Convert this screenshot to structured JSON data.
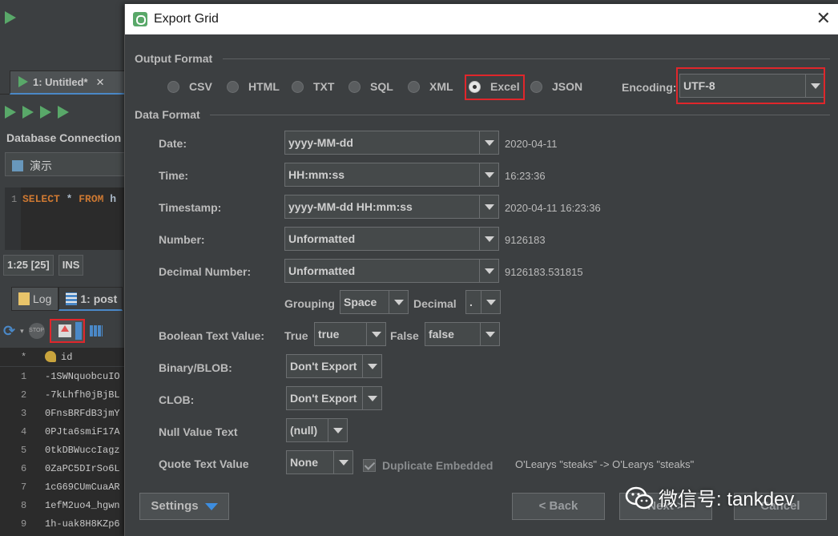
{
  "ide": {
    "editor_tab": "1: Untitled*",
    "editor_tab_close": "✕",
    "db_connection_label": "Database Connection",
    "db_selected": "演示",
    "line_number": "1",
    "sql_keyword_1": "SELECT",
    "sql_star": " * ",
    "sql_keyword_2": "FROM",
    "sql_rest": " h",
    "cursor_pos": "1:25 [25]",
    "ins_mode": "INS",
    "bottom_tabs": [
      "Log",
      "1: post"
    ],
    "stop_label": "STOP",
    "grid_header_star": "*",
    "grid_header_col": "id",
    "grid_rows": [
      {
        "n": "1",
        "v": "-1SWNquobcuIO"
      },
      {
        "n": "2",
        "v": "-7kLhfh0jBjBL"
      },
      {
        "n": "3",
        "v": "0FnsBRFdB3jmY"
      },
      {
        "n": "4",
        "v": "0PJta6smiF17A"
      },
      {
        "n": "5",
        "v": "0tkDBWuccIagz"
      },
      {
        "n": "6",
        "v": "0ZaPC5DIrSo6L"
      },
      {
        "n": "7",
        "v": "1cG69CUmCuaAR"
      },
      {
        "n": "8",
        "v": "1efM2uo4_hgwn"
      },
      {
        "n": "9",
        "v": "1h-uak8H8KZp6"
      }
    ]
  },
  "dialog": {
    "title": "Export Grid",
    "close": "✕",
    "output_format_label": "Output Format",
    "formats": [
      "CSV",
      "HTML",
      "TXT",
      "SQL",
      "XML",
      "Excel",
      "JSON"
    ],
    "selected_format": "Excel",
    "encoding_label": "Encoding:",
    "encoding_value": "UTF-8",
    "data_format_label": "Data Format",
    "fields": {
      "date": {
        "label": "Date:",
        "value": "yyyy-MM-dd",
        "sample": "2020-04-11"
      },
      "time": {
        "label": "Time:",
        "value": "HH:mm:ss",
        "sample": "16:23:36"
      },
      "timestamp": {
        "label": "Timestamp:",
        "value": "yyyy-MM-dd HH:mm:ss",
        "sample": "2020-04-11 16:23:36"
      },
      "number": {
        "label": "Number:",
        "value": "Unformatted",
        "sample": "9126183"
      },
      "decimal": {
        "label": "Decimal Number:",
        "value": "Unformatted",
        "sample": "9126183.531815"
      }
    },
    "grouping_label": "Grouping",
    "grouping_value": "Space",
    "decimal_label": "Decimal",
    "decimal_value": ".",
    "boolean_label": "Boolean Text Value:",
    "true_label": "True",
    "true_value": "true",
    "false_label": "False",
    "false_value": "false",
    "blob_label": "Binary/BLOB:",
    "blob_value": "Don't Export",
    "clob_label": "CLOB:",
    "clob_value": "Don't Export",
    "null_label": "Null Value Text",
    "null_value": "(null)",
    "quote_label": "Quote Text Value",
    "quote_value": "None",
    "duplicate_label": "Duplicate Embedded",
    "quote_sample": "O'Learys \"steaks\" -> O'Learys \"steaks\"",
    "settings_button": "Settings",
    "back_button": "< Back",
    "next_button": "Next >",
    "cancel_button": "Cancel"
  },
  "watermark": {
    "text": "微信号: tankdev"
  },
  "colors": {
    "accent": "#4a88c7",
    "highlight": "#e0262b",
    "run_green": "#59a869"
  }
}
